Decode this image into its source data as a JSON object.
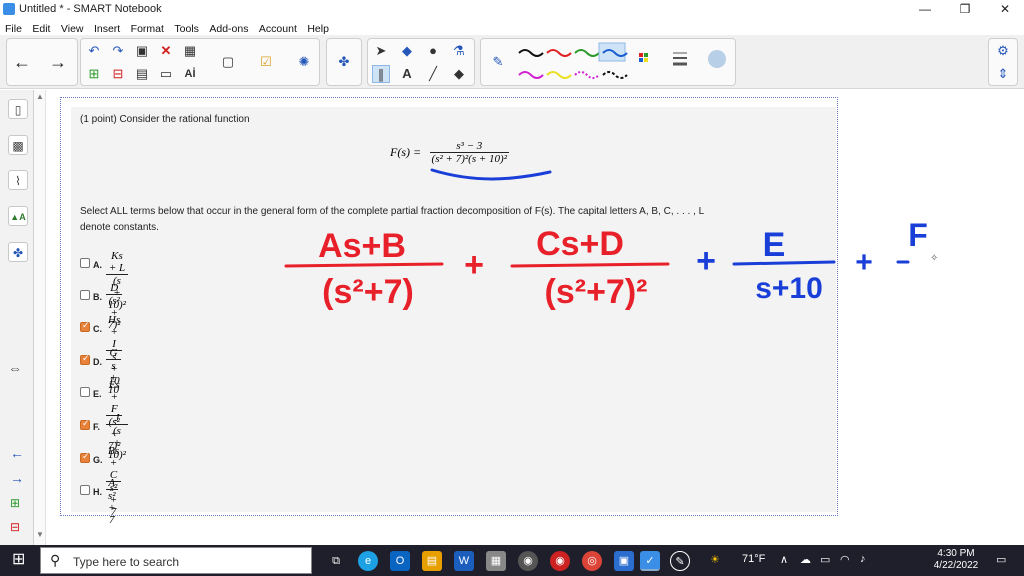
{
  "window": {
    "title": "Untitled * - SMART Notebook"
  },
  "menu": [
    "File",
    "Edit",
    "View",
    "Insert",
    "Format",
    "Tools",
    "Add-ons",
    "Account",
    "Help"
  ],
  "toolbar": {
    "text_tool_label": "A",
    "color_line_colors": [
      "#111111",
      "#e02020",
      "#2a9a2a",
      "#1a5fd0",
      "#d020d0",
      "#e8e020",
      "#d020d0",
      "#111111"
    ]
  },
  "problem": {
    "intro": "(1 point) Consider the rational function",
    "func_lhs": "F(s) =",
    "func_num": "s³ − 3",
    "func_den": "(s² + 7)²(s + 10)²",
    "instructions_1": "Select ALL terms below that occur in the general form of the complete partial fraction decomposition of F(s). The capital letters A, B, C, . . . , L",
    "instructions_2": "denote constants.",
    "options": [
      {
        "letter": "A.",
        "num": "Ks + L",
        "den": "(s + 10)²",
        "checked": false
      },
      {
        "letter": "B.",
        "num": "D",
        "den": "(s² + 7)²",
        "checked": false
      },
      {
        "letter": "C.",
        "num": "Hs + I",
        "den": "s + 10",
        "checked": true
      },
      {
        "letter": "D.",
        "num": "G",
        "den": "s + 10",
        "checked": true
      },
      {
        "letter": "E.",
        "num": "Es + F",
        "den": "(s² + 7)²",
        "checked": false
      },
      {
        "letter": "F.",
        "num": "J",
        "den": "(s + 10)²",
        "checked": true
      },
      {
        "letter": "G.",
        "num": "Bs + C",
        "den": "s² + 7",
        "checked": true
      },
      {
        "letter": "H.",
        "num": "A",
        "den": "s² + 7",
        "checked": false
      }
    ]
  },
  "handwriting": {
    "color_red": "#e8202a",
    "color_blue": "#1a3fd8",
    "term1_num": "As+B",
    "term1_den": "(s²+7)",
    "term2_num": "Cs+D",
    "term2_den": "(s²+7)²",
    "term3_num": "E",
    "term3_den": "s+10",
    "plus": "+",
    "term4_start": "F"
  },
  "taskbar": {
    "search_placeholder": "Type here to search",
    "weather": "71°F",
    "time": "4:30 PM",
    "date": "4/22/2022"
  }
}
